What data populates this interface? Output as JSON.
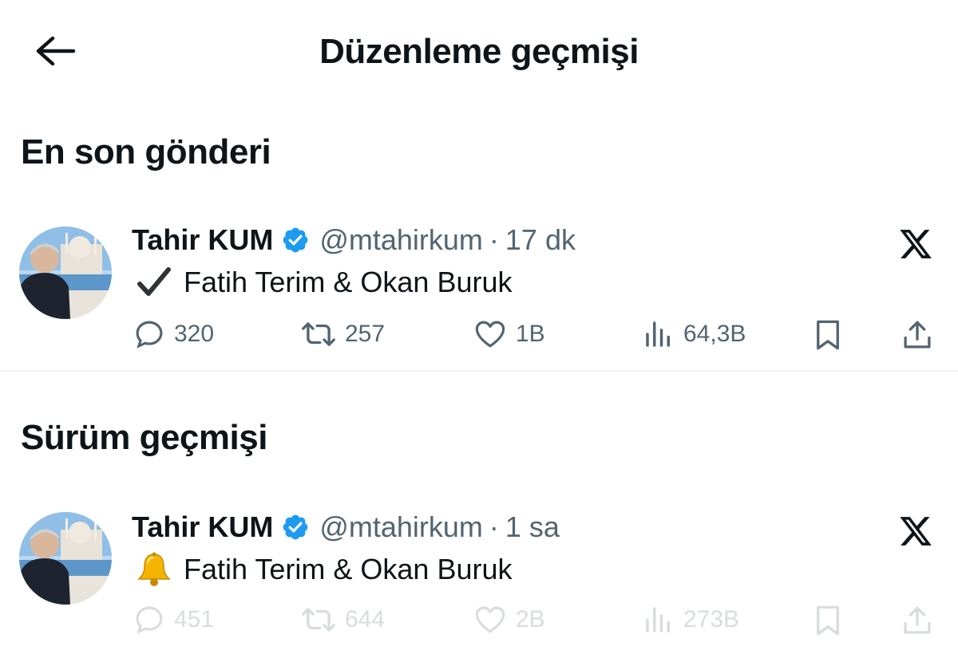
{
  "header": {
    "title": "Düzenleme geçmişi",
    "back_icon": "arrow-left-icon"
  },
  "sections": {
    "latest": "En son gönderi",
    "history": "Sürüm geçmişi"
  },
  "colors": {
    "text": "#0f1419",
    "muted": "#536471",
    "verified": "#1d9bf0",
    "divider": "#eff3f4"
  },
  "latest_post": {
    "author": "Tahir KUM",
    "handle": "@mtahirkum",
    "separator": "·",
    "time": "17 dk",
    "emoji": "✔",
    "text": "Fatih Terim & Okan Buruk",
    "stats": {
      "replies": "320",
      "reposts": "257",
      "likes": "1B",
      "views": "64,3B"
    }
  },
  "previous_post": {
    "author": "Tahir KUM",
    "handle": "@mtahirkum",
    "separator": "·",
    "time": "1 sa",
    "emoji": "🔔",
    "text": "Fatih Terim & Okan Buruk",
    "stats": {
      "replies": "451",
      "reposts": "644",
      "likes": "2B",
      "views": "273B"
    }
  }
}
